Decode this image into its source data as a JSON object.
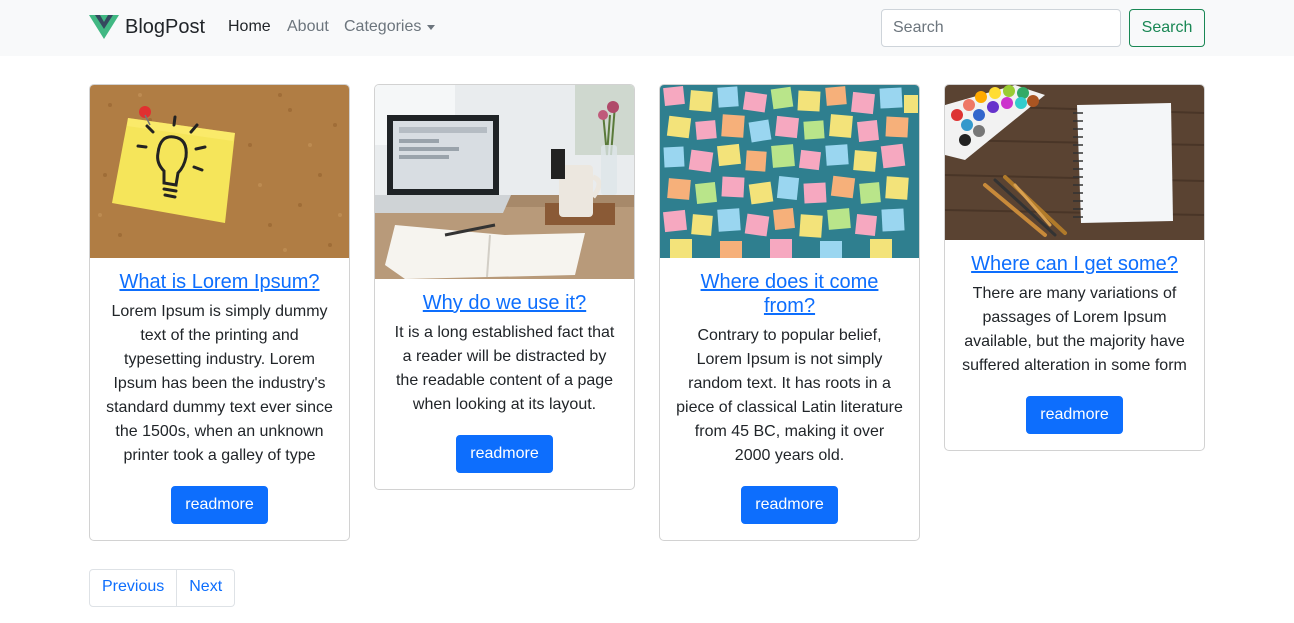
{
  "navbar": {
    "brand": "BlogPost",
    "links": [
      {
        "label": "Home"
      },
      {
        "label": "About"
      },
      {
        "label": "Categories"
      }
    ],
    "search_placeholder": "Search",
    "search_button": "Search",
    "colors": {
      "background": "#f8f9fa",
      "search_button": "#198754",
      "logo_green": "#41b883",
      "logo_dark": "#35495e"
    }
  },
  "cards": [
    {
      "image": "sticky-note-lightbulb-on-corkboard",
      "title": "What is Lorem Ipsum?",
      "text": "Lorem Ipsum is simply dummy text of the printing and typesetting industry. Lorem Ipsum has been the industry's standard dummy text ever since the 1500s, when an unknown printer took a galley of type",
      "button": "readmore"
    },
    {
      "image": "laptop-and-open-notebook-on-desk",
      "title": "Why do we use it?",
      "text": "It is a long established fact that a reader will be distracted by the readable content of a page when looking at its layout.",
      "button": "readmore"
    },
    {
      "image": "wall-of-colorful-sticky-notes",
      "title": "Where does it come from?",
      "text": "Contrary to popular belief, Lorem Ipsum is not simply random text. It has roots in a piece of classical Latin literature from 45 BC, making it over 2000 years old.",
      "button": "readmore"
    },
    {
      "image": "watercolor-palette-and-sketchbook",
      "title": "Where can I get some?",
      "text": "There are many variations of passages of Lorem Ipsum available, but the majority have suffered alteration in some form",
      "button": "readmore"
    }
  ],
  "pagination": {
    "previous": "Previous",
    "next": "Next"
  },
  "colors": {
    "primary": "#0d6efd",
    "text": "#212529",
    "muted": "#6c757d"
  }
}
